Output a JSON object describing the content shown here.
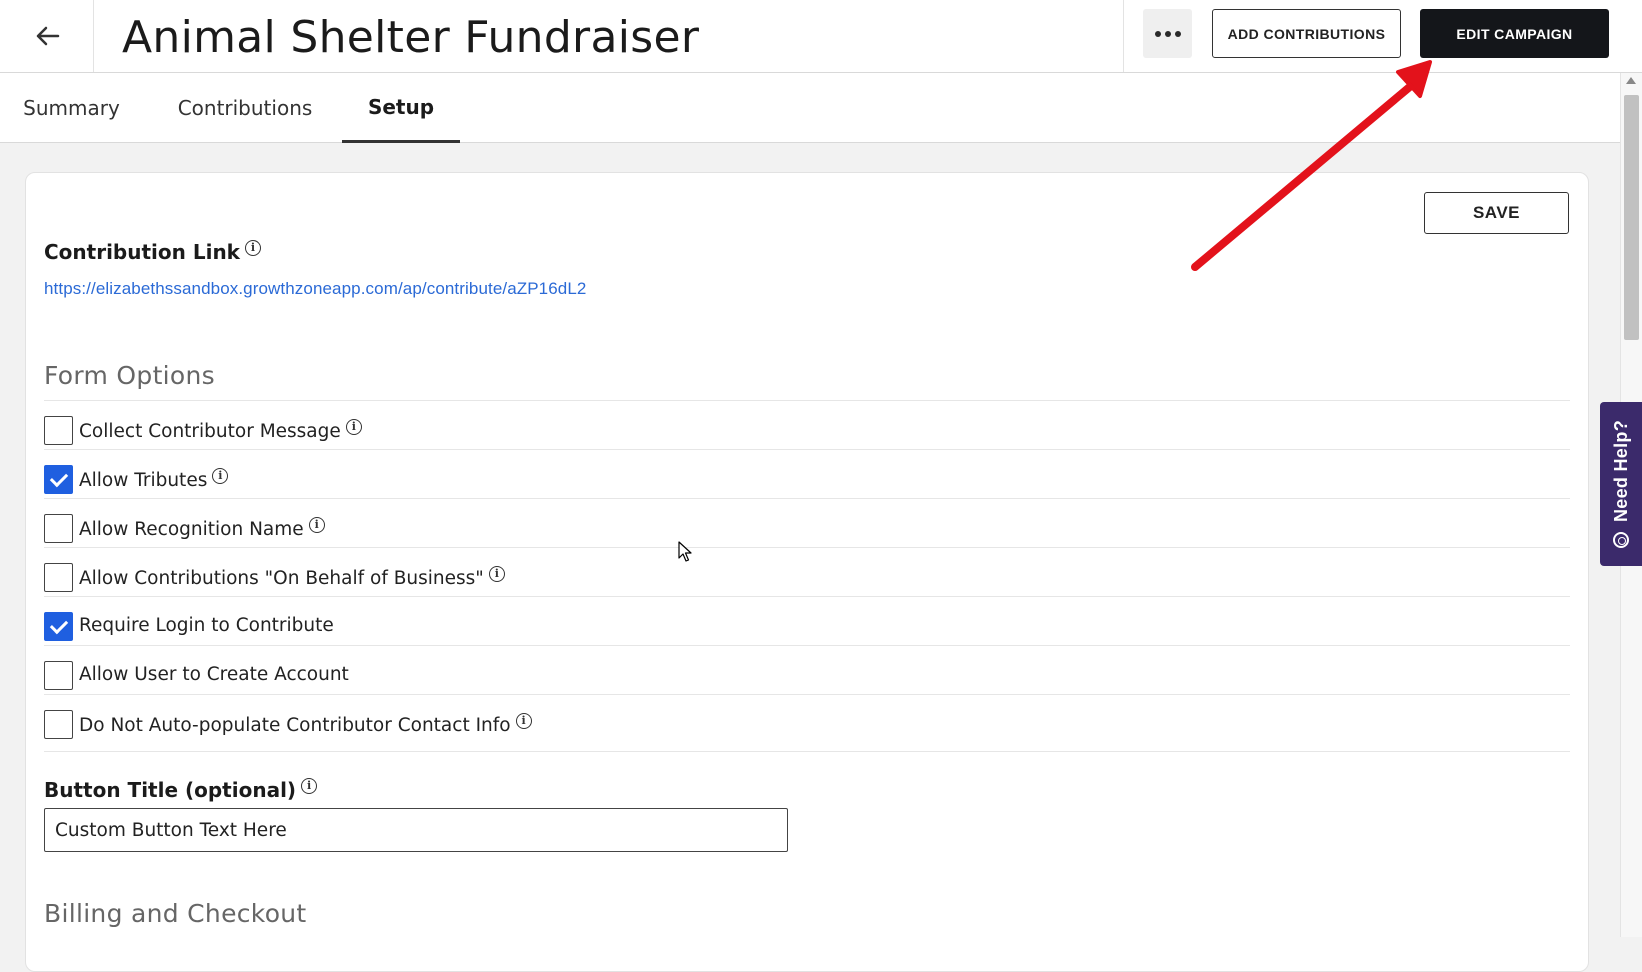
{
  "header": {
    "title": "Animal Shelter Fundraiser",
    "more_label": "•••",
    "add_contributions_label": "ADD CONTRIBUTIONS",
    "edit_campaign_label": "EDIT CAMPAIGN"
  },
  "tabs": [
    {
      "label": "Summary",
      "active": false
    },
    {
      "label": "Contributions",
      "active": false
    },
    {
      "label": "Setup",
      "active": true
    }
  ],
  "setup": {
    "save_label": "SAVE",
    "contribution_link_label": "Contribution Link",
    "contribution_link_url": "https://elizabethssandbox.growthzoneapp.com/ap/contribute/aZP16dL2",
    "form_options_title": "Form Options",
    "options": [
      {
        "label": "Collect Contributor Message",
        "checked": false,
        "info": true
      },
      {
        "label": "Allow Tributes",
        "checked": true,
        "info": true
      },
      {
        "label": "Allow Recognition Name",
        "checked": false,
        "info": true
      },
      {
        "label": "Allow Contributions \"On Behalf of Business\"",
        "checked": false,
        "info": true
      },
      {
        "label": "Require Login to Contribute",
        "checked": true,
        "info": false
      },
      {
        "label": "Allow User to Create Account",
        "checked": false,
        "info": false
      },
      {
        "label": "Do Not Auto-populate Contributor Contact Info",
        "checked": false,
        "info": true
      }
    ],
    "button_title_label": "Button Title (optional)",
    "button_title_value": "Custom Button Text Here",
    "billing_title": "Billing and Checkout"
  },
  "help_widget": {
    "label": "Need Help?"
  },
  "colors": {
    "accent": "#1f5fe0",
    "link": "#2b6ad6",
    "primary_button": "#14161a",
    "help_widget": "#3b2a6b",
    "annotation_arrow": "#e3121b"
  },
  "icons": {
    "back": "arrow-left-icon",
    "info": "info-circle-icon",
    "help": "lifebuoy-icon"
  }
}
